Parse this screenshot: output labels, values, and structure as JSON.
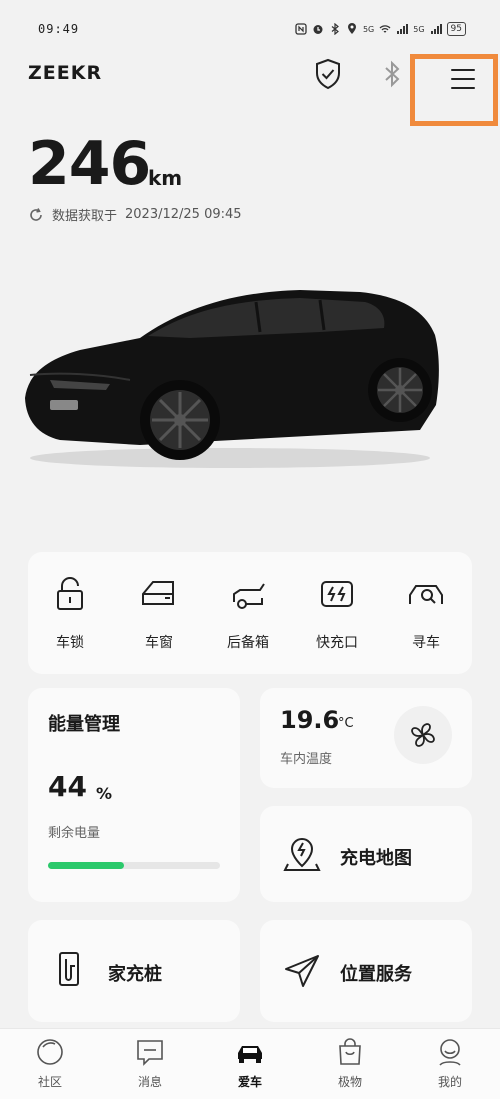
{
  "status_bar": {
    "time": "09:49",
    "battery": "95",
    "signal1": "5G",
    "signal2": "5G"
  },
  "header": {
    "brand": "ZEEKR",
    "icons": [
      "shield-check-icon",
      "bluetooth-icon",
      "menu-icon"
    ]
  },
  "range": {
    "value": "246",
    "unit": "km",
    "updated_label": "数据获取于",
    "updated_time": "2023/12/25 09:45"
  },
  "quick_actions": [
    {
      "label": "车锁",
      "icon": "lock-icon"
    },
    {
      "label": "车窗",
      "icon": "window-icon"
    },
    {
      "label": "后备箱",
      "icon": "trunk-icon"
    },
    {
      "label": "快充口",
      "icon": "fast-charge-port-icon"
    },
    {
      "label": "寻车",
      "icon": "find-car-icon"
    }
  ],
  "energy": {
    "title": "能量管理",
    "battery_value": "44",
    "battery_unit": "%",
    "battery_label": "剩余电量",
    "battery_fraction": 0.44,
    "bar_color": "#2bc96b"
  },
  "climate": {
    "temperature": "19.6",
    "unit": "°C",
    "label": "车内温度"
  },
  "shortcuts": {
    "charging_map": "充电地图",
    "home_charger": "家充桩",
    "location_service": "位置服务"
  },
  "bottom_nav": {
    "items": [
      {
        "label": "社区",
        "icon": "community-icon"
      },
      {
        "label": "消息",
        "icon": "message-icon"
      },
      {
        "label": "爱车",
        "icon": "car-icon",
        "active": true
      },
      {
        "label": "极物",
        "icon": "shopping-bag-icon"
      },
      {
        "label": "我的",
        "icon": "profile-icon"
      }
    ]
  },
  "colors": {
    "highlight_border": "#f08a3c",
    "background": "#f2f2f2"
  }
}
